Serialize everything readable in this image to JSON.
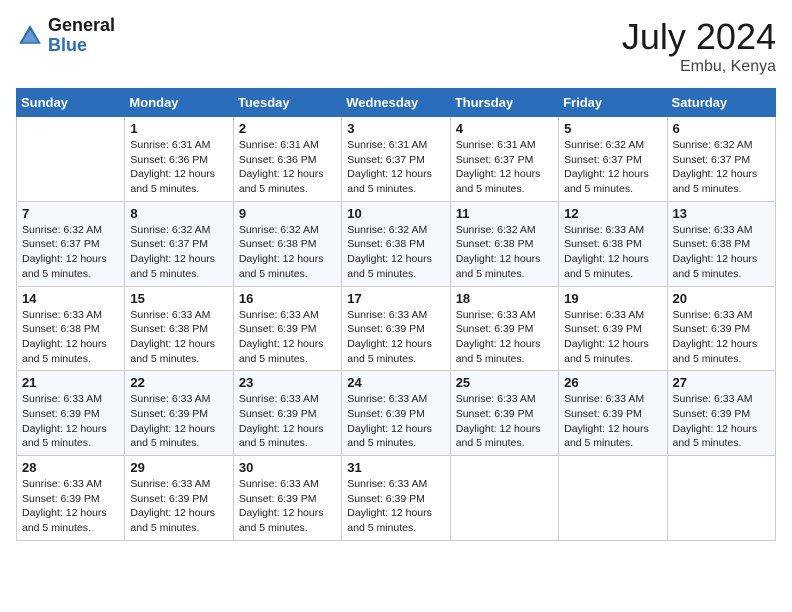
{
  "header": {
    "logo_general": "General",
    "logo_blue": "Blue",
    "month_year": "July 2024",
    "location": "Embu, Kenya"
  },
  "days_of_week": [
    "Sunday",
    "Monday",
    "Tuesday",
    "Wednesday",
    "Thursday",
    "Friday",
    "Saturday"
  ],
  "weeks": [
    [
      {
        "day": "",
        "info": ""
      },
      {
        "day": "1",
        "info": "Sunrise: 6:31 AM\nSunset: 6:36 PM\nDaylight: 12 hours\nand 5 minutes."
      },
      {
        "day": "2",
        "info": "Sunrise: 6:31 AM\nSunset: 6:36 PM\nDaylight: 12 hours\nand 5 minutes."
      },
      {
        "day": "3",
        "info": "Sunrise: 6:31 AM\nSunset: 6:37 PM\nDaylight: 12 hours\nand 5 minutes."
      },
      {
        "day": "4",
        "info": "Sunrise: 6:31 AM\nSunset: 6:37 PM\nDaylight: 12 hours\nand 5 minutes."
      },
      {
        "day": "5",
        "info": "Sunrise: 6:32 AM\nSunset: 6:37 PM\nDaylight: 12 hours\nand 5 minutes."
      },
      {
        "day": "6",
        "info": "Sunrise: 6:32 AM\nSunset: 6:37 PM\nDaylight: 12 hours\nand 5 minutes."
      }
    ],
    [
      {
        "day": "7",
        "info": "Sunrise: 6:32 AM\nSunset: 6:37 PM\nDaylight: 12 hours\nand 5 minutes."
      },
      {
        "day": "8",
        "info": "Sunrise: 6:32 AM\nSunset: 6:37 PM\nDaylight: 12 hours\nand 5 minutes."
      },
      {
        "day": "9",
        "info": "Sunrise: 6:32 AM\nSunset: 6:38 PM\nDaylight: 12 hours\nand 5 minutes."
      },
      {
        "day": "10",
        "info": "Sunrise: 6:32 AM\nSunset: 6:38 PM\nDaylight: 12 hours\nand 5 minutes."
      },
      {
        "day": "11",
        "info": "Sunrise: 6:32 AM\nSunset: 6:38 PM\nDaylight: 12 hours\nand 5 minutes."
      },
      {
        "day": "12",
        "info": "Sunrise: 6:33 AM\nSunset: 6:38 PM\nDaylight: 12 hours\nand 5 minutes."
      },
      {
        "day": "13",
        "info": "Sunrise: 6:33 AM\nSunset: 6:38 PM\nDaylight: 12 hours\nand 5 minutes."
      }
    ],
    [
      {
        "day": "14",
        "info": "Sunrise: 6:33 AM\nSunset: 6:38 PM\nDaylight: 12 hours\nand 5 minutes."
      },
      {
        "day": "15",
        "info": "Sunrise: 6:33 AM\nSunset: 6:38 PM\nDaylight: 12 hours\nand 5 minutes."
      },
      {
        "day": "16",
        "info": "Sunrise: 6:33 AM\nSunset: 6:39 PM\nDaylight: 12 hours\nand 5 minutes."
      },
      {
        "day": "17",
        "info": "Sunrise: 6:33 AM\nSunset: 6:39 PM\nDaylight: 12 hours\nand 5 minutes."
      },
      {
        "day": "18",
        "info": "Sunrise: 6:33 AM\nSunset: 6:39 PM\nDaylight: 12 hours\nand 5 minutes."
      },
      {
        "day": "19",
        "info": "Sunrise: 6:33 AM\nSunset: 6:39 PM\nDaylight: 12 hours\nand 5 minutes."
      },
      {
        "day": "20",
        "info": "Sunrise: 6:33 AM\nSunset: 6:39 PM\nDaylight: 12 hours\nand 5 minutes."
      }
    ],
    [
      {
        "day": "21",
        "info": "Sunrise: 6:33 AM\nSunset: 6:39 PM\nDaylight: 12 hours\nand 5 minutes."
      },
      {
        "day": "22",
        "info": "Sunrise: 6:33 AM\nSunset: 6:39 PM\nDaylight: 12 hours\nand 5 minutes."
      },
      {
        "day": "23",
        "info": "Sunrise: 6:33 AM\nSunset: 6:39 PM\nDaylight: 12 hours\nand 5 minutes."
      },
      {
        "day": "24",
        "info": "Sunrise: 6:33 AM\nSunset: 6:39 PM\nDaylight: 12 hours\nand 5 minutes."
      },
      {
        "day": "25",
        "info": "Sunrise: 6:33 AM\nSunset: 6:39 PM\nDaylight: 12 hours\nand 5 minutes."
      },
      {
        "day": "26",
        "info": "Sunrise: 6:33 AM\nSunset: 6:39 PM\nDaylight: 12 hours\nand 5 minutes."
      },
      {
        "day": "27",
        "info": "Sunrise: 6:33 AM\nSunset: 6:39 PM\nDaylight: 12 hours\nand 5 minutes."
      }
    ],
    [
      {
        "day": "28",
        "info": "Sunrise: 6:33 AM\nSunset: 6:39 PM\nDaylight: 12 hours\nand 5 minutes."
      },
      {
        "day": "29",
        "info": "Sunrise: 6:33 AM\nSunset: 6:39 PM\nDaylight: 12 hours\nand 5 minutes."
      },
      {
        "day": "30",
        "info": "Sunrise: 6:33 AM\nSunset: 6:39 PM\nDaylight: 12 hours\nand 5 minutes."
      },
      {
        "day": "31",
        "info": "Sunrise: 6:33 AM\nSunset: 6:39 PM\nDaylight: 12 hours\nand 5 minutes."
      },
      {
        "day": "",
        "info": ""
      },
      {
        "day": "",
        "info": ""
      },
      {
        "day": "",
        "info": ""
      }
    ]
  ]
}
